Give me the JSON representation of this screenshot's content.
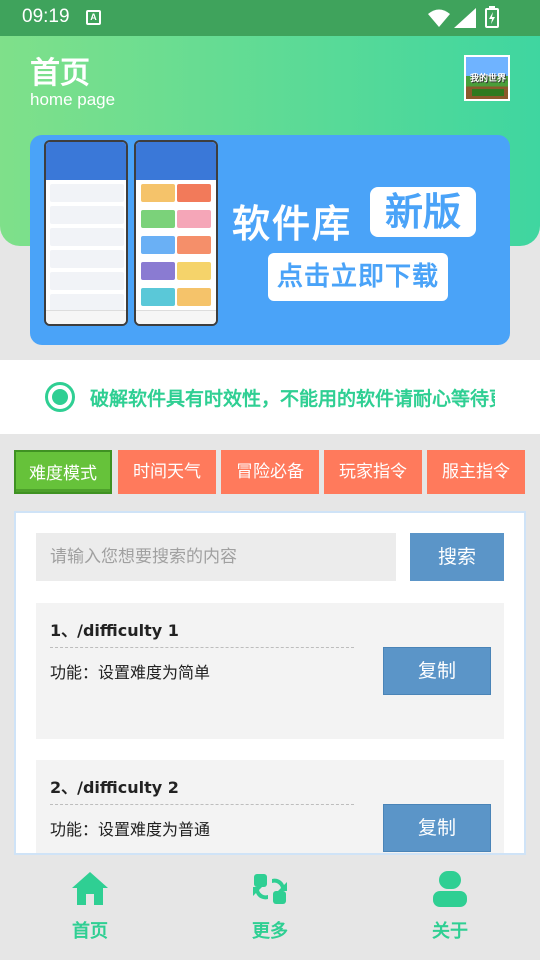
{
  "status_bar": {
    "time": "09:19",
    "notification_icon": "A"
  },
  "header": {
    "title": "首页",
    "subtitle": "home page",
    "avatar_logo_text": "我的世界"
  },
  "banner": {
    "title": "软件库",
    "tag": "新版",
    "cta": "点击立即下载"
  },
  "notice": {
    "text": "破解软件具有时效性，不能用的软件请耐心等待更新"
  },
  "tabs": [
    {
      "label": "难度模式",
      "active": true
    },
    {
      "label": "时间天气",
      "active": false
    },
    {
      "label": "冒险必备",
      "active": false
    },
    {
      "label": "玩家指令",
      "active": false
    },
    {
      "label": "服主指令",
      "active": false
    }
  ],
  "search": {
    "placeholder": "请输入您想要搜索的内容",
    "button_label": "搜索"
  },
  "commands": [
    {
      "command": "1、/difficulty 1",
      "description": "功能：设置难度为简单",
      "copy_label": "复制"
    },
    {
      "command": "2、/difficulty 2",
      "description": "功能：设置难度为普通",
      "copy_label": "复制"
    }
  ],
  "bottom_nav": [
    {
      "label": "首页",
      "icon": "home-icon"
    },
    {
      "label": "更多",
      "icon": "refresh-icon"
    },
    {
      "label": "关于",
      "icon": "user-icon"
    }
  ],
  "colors": {
    "accent": "#2fcf93",
    "tab": "#ff7a5c",
    "tab_active": "#66c23a",
    "button": "#5b95c8",
    "banner": "#4aa3f8"
  }
}
